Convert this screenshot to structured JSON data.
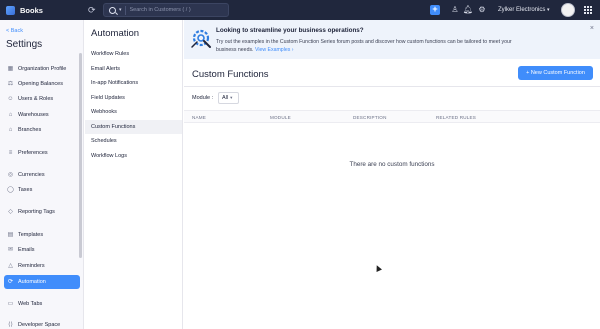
{
  "topbar": {
    "app_name": "Books",
    "search_placeholder": "Search in Customers ( / )",
    "org_name": "Zylker Electronics",
    "org_caret": "▾",
    "icons": [
      "refresh-icon",
      "search-icon",
      "add-icon",
      "people-icon",
      "bell-icon",
      "gear-icon",
      "apps-grid-icon"
    ]
  },
  "settings": {
    "back_label": "< Back",
    "title": "Settings",
    "items": [
      {
        "label": "Organization Profile",
        "icon": "building-icon",
        "glyph": "▦"
      },
      {
        "label": "Opening Balances",
        "icon": "scale-icon",
        "glyph": "⚖"
      },
      {
        "label": "Users & Roles",
        "icon": "users-icon",
        "glyph": "☺"
      },
      {
        "label": "Warehouses",
        "icon": "warehouse-icon",
        "glyph": "⌂"
      },
      {
        "label": "Branches",
        "icon": "branch-icon",
        "glyph": "⌂"
      },
      {
        "label": "Preferences",
        "icon": "sliders-icon",
        "glyph": "≡"
      },
      {
        "label": "Currencies",
        "icon": "currency-icon",
        "glyph": "◎"
      },
      {
        "label": "Taxes",
        "icon": "percent-icon",
        "glyph": "◯"
      },
      {
        "label": "Reporting Tags",
        "icon": "tag-icon",
        "glyph": "◇"
      },
      {
        "label": "Templates",
        "icon": "template-icon",
        "glyph": "▤"
      },
      {
        "label": "Emails",
        "icon": "mail-icon",
        "glyph": "✉"
      },
      {
        "label": "Reminders",
        "icon": "bell-icon",
        "glyph": "△"
      },
      {
        "label": "Automation",
        "icon": "automation-icon",
        "glyph": "⟳"
      },
      {
        "label": "Web Tabs",
        "icon": "web-tab-icon",
        "glyph": "▭"
      },
      {
        "label": "Developer Space",
        "icon": "code-icon",
        "glyph": "⟨⟩"
      }
    ],
    "active": "Automation"
  },
  "automation": {
    "title": "Automation",
    "items": [
      "Workflow Rules",
      "Email Alerts",
      "In-app Notifications",
      "Field Updates",
      "Webhooks",
      "Custom Functions",
      "Schedules",
      "Workflow Logs"
    ],
    "active": "Custom Functions"
  },
  "banner": {
    "title": "Looking to streamline your business operations?",
    "text": "Try out the examples in the Custom Function Series forum posts and discover how custom functions can be tailored to meet your business needs.",
    "link_label": "View Examples ›",
    "close_label": "×",
    "icon": "gear-wrench-icon"
  },
  "page": {
    "title": "Custom Functions",
    "new_button_label": "+ New Custom Function",
    "module_label": "Module :",
    "module_value": "All",
    "module_caret": "▾",
    "columns": [
      "NAME",
      "MODULE",
      "DESCRIPTION",
      "RELATED RULES"
    ],
    "empty_message": "There are no custom functions"
  },
  "colors": {
    "accent": "#408dfb",
    "topbar": "#20273d",
    "banner_bg": "#eef3fb",
    "sidebar_bg": "#f7f7fb"
  }
}
